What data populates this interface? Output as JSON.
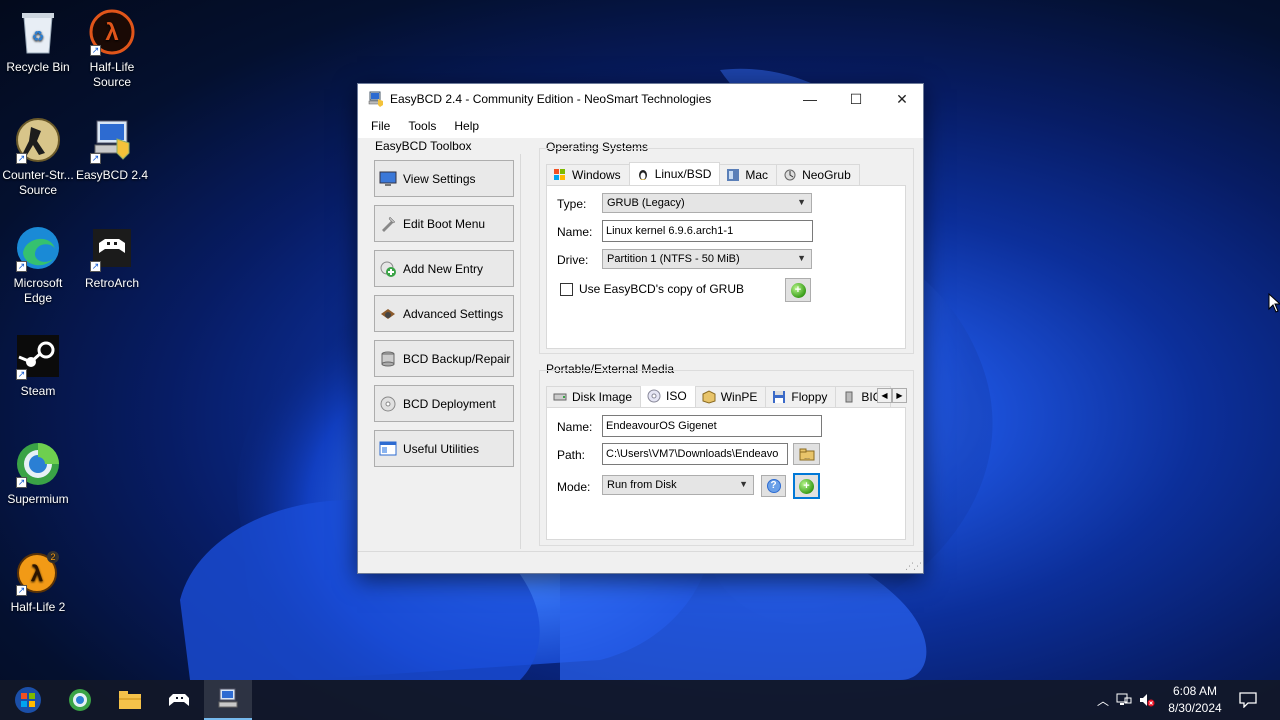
{
  "desktop": {
    "icons": [
      {
        "label": "Recycle Bin",
        "icon": "recycle-bin-icon"
      },
      {
        "label": "Half-Life Source",
        "icon": "half-life-icon"
      },
      {
        "label": "Counter-Str... Source",
        "icon": "counter-strike-icon"
      },
      {
        "label": "EasyBCD 2.4",
        "icon": "easybcd-icon"
      },
      {
        "label": "Microsoft Edge",
        "icon": "edge-icon"
      },
      {
        "label": "RetroArch",
        "icon": "retroarch-icon"
      },
      {
        "label": "Steam",
        "icon": "steam-icon"
      },
      {
        "label": "Supermium",
        "icon": "supermium-icon"
      },
      {
        "label": "Half-Life 2",
        "icon": "half-life-2-icon"
      }
    ]
  },
  "window": {
    "title": "EasyBCD 2.4 - Community Edition - NeoSmart Technologies",
    "controls": {
      "minimize": "—",
      "maximize": "☐",
      "close": "✕"
    },
    "menu": [
      "File",
      "Tools",
      "Help"
    ],
    "toolbox": {
      "label": "EasyBCD Toolbox",
      "buttons": [
        "View Settings",
        "Edit Boot Menu",
        "Add New Entry",
        "Advanced Settings",
        "BCD Backup/Repair",
        "BCD Deployment",
        "Useful Utilities"
      ]
    },
    "os_group": {
      "label": "Operating Systems",
      "tabs": [
        "Windows",
        "Linux/BSD",
        "Mac",
        "NeoGrub"
      ],
      "active_tab": "Linux/BSD",
      "type_label": "Type:",
      "type_value": "GRUB (Legacy)",
      "name_label": "Name:",
      "name_value": "Linux kernel 6.9.6.arch1-1",
      "drive_label": "Drive:",
      "drive_value": "Partition 1 (NTFS - 50 MiB)",
      "checkbox_label": "Use EasyBCD's copy of GRUB",
      "checkbox_checked": false
    },
    "media_group": {
      "label": "Portable/External Media",
      "tabs": [
        "Disk Image",
        "ISO",
        "WinPE",
        "Floppy",
        "BIOS"
      ],
      "active_tab": "ISO",
      "name_label": "Name:",
      "name_value": "EndeavourOS Gigenet",
      "path_label": "Path:",
      "path_value": "C:\\Users\\VM7\\Downloads\\Endeavo",
      "mode_label": "Mode:",
      "mode_value": "Run from Disk"
    }
  },
  "taskbar": {
    "time": "6:08 AM",
    "date": "8/30/2024"
  },
  "colors": {
    "accent": "#0078d7",
    "window_bg": "#f0f0f0",
    "taskbar_bg": "#121828"
  }
}
